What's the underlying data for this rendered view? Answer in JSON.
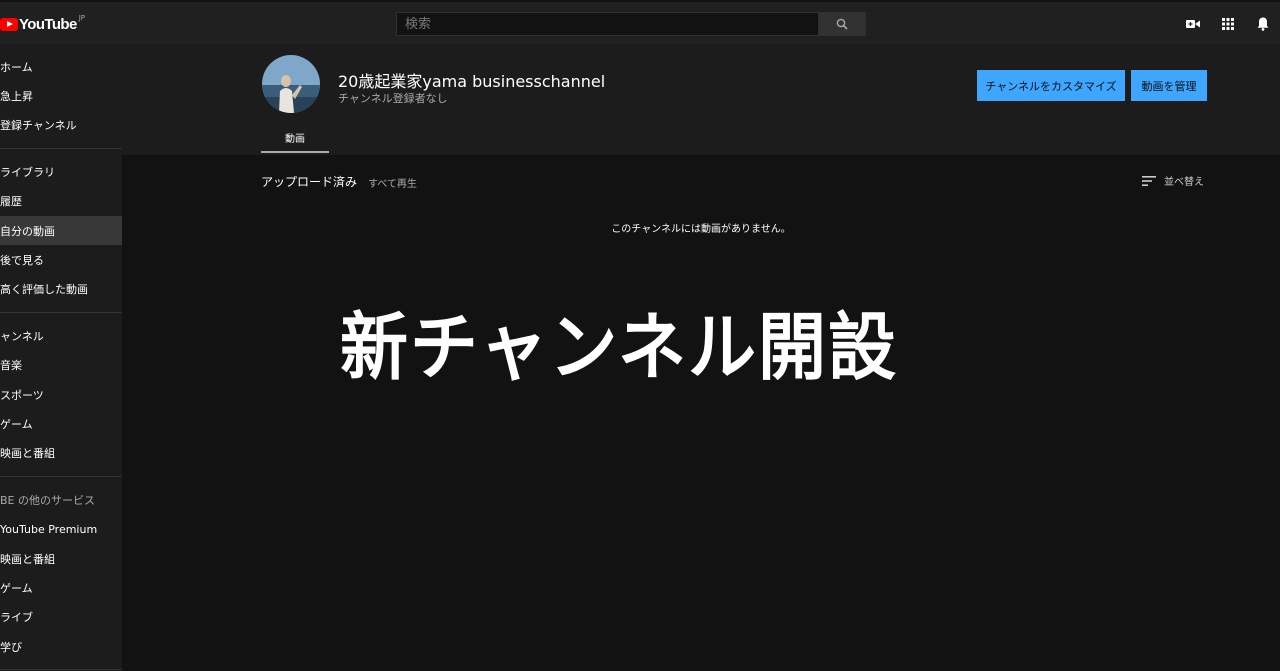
{
  "app": {
    "logo_text": "YouTube",
    "logo_region": "JP"
  },
  "search": {
    "placeholder": "検索"
  },
  "topbar": {
    "icons": [
      "video-camera-icon",
      "apps-grid-icon",
      "bell-icon"
    ]
  },
  "sidebar": {
    "items": [
      {
        "label": "ホーム",
        "icon": "home-icon"
      },
      {
        "label": "急上昇",
        "icon": "trending-icon"
      },
      {
        "label": "登録チャンネル",
        "icon": "subscriptions-icon"
      },
      {
        "label": "ライブラリ",
        "icon": "library-icon"
      },
      {
        "label": "履歴",
        "icon": "history-icon"
      },
      {
        "label": "自分の動画",
        "icon": "my-videos-icon",
        "active": true
      },
      {
        "label": "後で見る",
        "icon": "watch-later-icon"
      },
      {
        "label": "高く評価した動画",
        "icon": "liked-icon"
      },
      {
        "label": "ャンネル",
        "icon": "channel-icon"
      },
      {
        "label": "音楽",
        "icon": "music-icon"
      },
      {
        "label": "スポーツ",
        "icon": "sports-icon"
      },
      {
        "label": "ゲーム",
        "icon": "gaming-icon"
      },
      {
        "label": "映画と番組",
        "icon": "movies-icon"
      },
      {
        "label": "BE の他のサービス"
      },
      {
        "label": "YouTube Premium",
        "icon": "premium-icon"
      },
      {
        "label": "映画と番組",
        "icon": "movies-icon"
      },
      {
        "label": "ゲーム",
        "icon": "gaming-icon"
      },
      {
        "label": "ライブ",
        "icon": "live-icon"
      },
      {
        "label": "学び",
        "icon": "learning-icon"
      }
    ]
  },
  "channel": {
    "name": "20歳起業家yama businesschannel",
    "subscribers": "チャンネル登録者なし",
    "customize_label": "チャンネルをカスタマイズ",
    "manage_label": "動画を管理",
    "tab_videos": "動画"
  },
  "content": {
    "uploads_title": "アップロード済み",
    "play_all": "すべて再生",
    "sort_label": "並べ替え",
    "empty_message": "このチャンネルには動画がありません。",
    "overlay_title": "新チャンネル開設"
  },
  "colors": {
    "accent": "#3ea6ff",
    "brand": "#ff0000",
    "sidebar_bg": "#1c1c1c",
    "main_bg": "#121212"
  }
}
